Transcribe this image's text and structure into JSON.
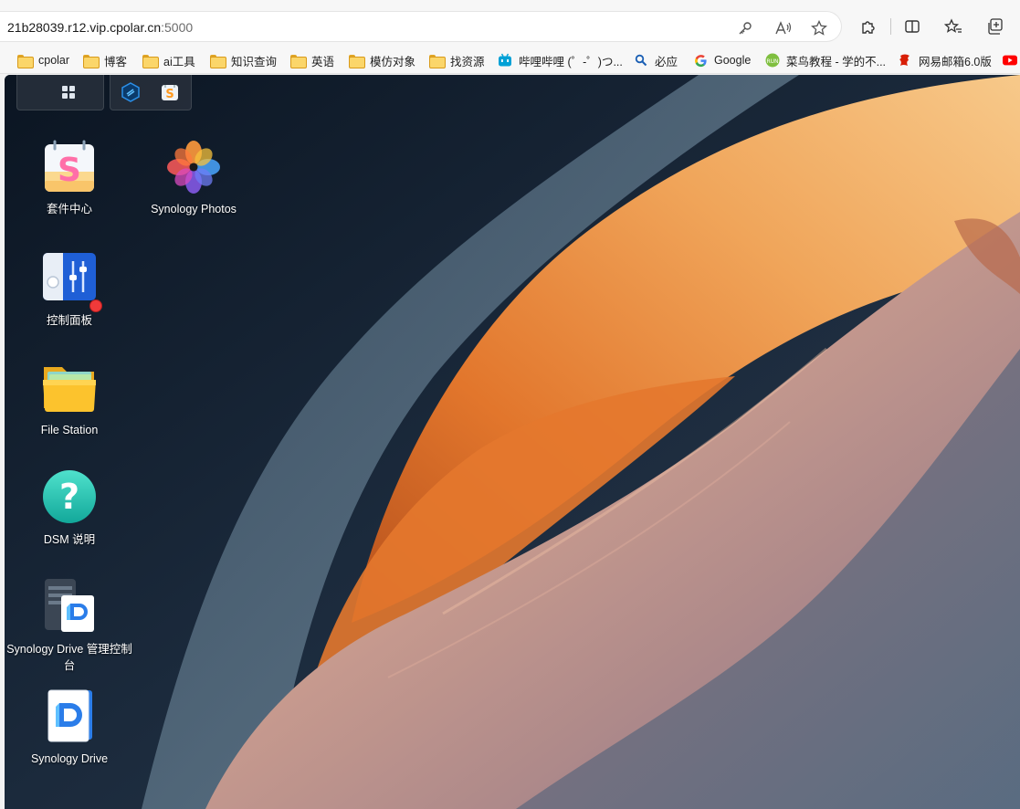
{
  "browser": {
    "url_host": "21b28039.r12.vip.cpolar.cn",
    "url_port": ":5000",
    "icons": [
      "key-icon",
      "read-aloud-icon",
      "star-icon",
      "extensions-icon",
      "split-screen-icon",
      "favorites-icon",
      "collections-icon"
    ]
  },
  "bookmarks": [
    {
      "label": "cpolar",
      "icon": "folder-icon"
    },
    {
      "label": "博客",
      "icon": "folder-icon"
    },
    {
      "label": "ai工具",
      "icon": "folder-icon"
    },
    {
      "label": "知识查询",
      "icon": "folder-icon"
    },
    {
      "label": "英语",
      "icon": "folder-icon"
    },
    {
      "label": "模仿对象",
      "icon": "folder-icon"
    },
    {
      "label": "找资源",
      "icon": "folder-icon"
    },
    {
      "label": "哔哩哔哩 (゜-゜)つ...",
      "icon": "bilibili-icon"
    },
    {
      "label": "必应",
      "icon": "bing-search-icon"
    },
    {
      "label": "Google",
      "icon": "google-icon"
    },
    {
      "label": "菜鸟教程 - 学的不...",
      "icon": "runoob-icon"
    },
    {
      "label": "网易邮箱6.0版",
      "icon": "netease-mail-icon"
    }
  ],
  "desktop": {
    "taskbar": [
      "main-menu-icon",
      "synology-drive-admin-icon",
      "package-center-icon"
    ],
    "apps": [
      {
        "label": "套件中心",
        "icon": "package-center-icon"
      },
      {
        "label": "Synology Photos",
        "icon": "synology-photos-icon"
      },
      {
        "label": "控制面板",
        "icon": "control-panel-icon",
        "badge": true
      },
      {
        "label": "File Station",
        "icon": "file-station-icon"
      },
      {
        "label": "DSM 说明",
        "icon": "help-icon"
      },
      {
        "label": "Synology Drive 管理控制台",
        "icon": "drive-admin-console-icon"
      },
      {
        "label": "Synology Drive",
        "icon": "synology-drive-icon"
      }
    ]
  },
  "colors": {
    "accent_blue": "#2b7de9",
    "badge_red": "#f03a3a",
    "folder_yellow": "#fbd66a"
  }
}
